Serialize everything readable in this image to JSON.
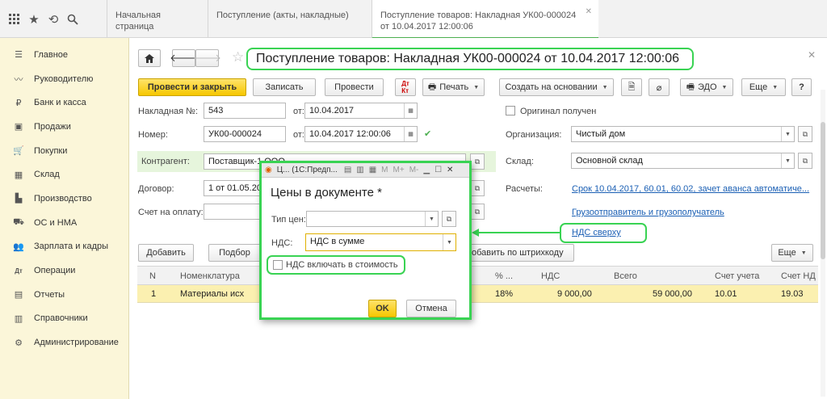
{
  "topbar": {
    "icons": [
      "apps-grid-icon",
      "star-icon",
      "history-icon",
      "search-icon"
    ],
    "tabs": [
      {
        "label": "Начальная страница"
      },
      {
        "label": "Поступление (акты, накладные)"
      },
      {
        "label_line1": "Поступление товаров: Накладная УК00-000024",
        "label_line2": "от 10.04.2017 12:00:06"
      }
    ]
  },
  "sidebar": {
    "items": [
      {
        "label": "Главное",
        "icon": "menu-icon"
      },
      {
        "label": "Руководителю",
        "icon": "chart-trend-icon"
      },
      {
        "label": "Банк и касса",
        "icon": "ruble-icon"
      },
      {
        "label": "Продажи",
        "icon": "bag-icon"
      },
      {
        "label": "Покупки",
        "icon": "cart-icon"
      },
      {
        "label": "Склад",
        "icon": "warehouse-icon"
      },
      {
        "label": "Производство",
        "icon": "factory-icon"
      },
      {
        "label": "ОС и НМА",
        "icon": "truck-icon"
      },
      {
        "label": "Зарплата и кадры",
        "icon": "people-icon"
      },
      {
        "label": "Операции",
        "icon": "dt-kt-icon"
      },
      {
        "label": "Отчеты",
        "icon": "report-icon"
      },
      {
        "label": "Справочники",
        "icon": "book-icon"
      },
      {
        "label": "Администрирование",
        "icon": "gear-icon"
      }
    ]
  },
  "document": {
    "title": "Поступление товаров: Накладная УК00-000024 от 10.04.2017 12:00:06",
    "toolbar": {
      "post_close": "Провести и закрыть",
      "save": "Записать",
      "post": "Провести",
      "print": "Печать",
      "create_based": "Создать на основании",
      "edo": "ЭДО",
      "more": "Еще",
      "help": "?"
    },
    "fields": {
      "invoice_label": "Накладная №:",
      "invoice_value": "543",
      "from_label": "от:",
      "invoice_date": "10.04.2017",
      "number_label": "Номер:",
      "number_value": "УК00-000024",
      "number_date": "10.04.2017 12:00:06",
      "original_label": "Оригинал получен",
      "org_label": "Организация:",
      "org_value": "Чистый дом",
      "counterparty_label": "Контрагент:",
      "counterparty_value": "Поставщик-1 ООО",
      "warehouse_label": "Склад:",
      "warehouse_value": "Основной склад",
      "contract_label": "Договор:",
      "contract_value": "1 от 01.05.20",
      "settlements_label": "Расчеты:",
      "settlements_link": "Срок 10.04.2017, 60.01, 60.02, зачет аванса автоматиче...",
      "payment_label": "Счет на оплату:",
      "consignor_link": "Грузоотправитель и грузополучатель",
      "vat_link": "НДС сверху"
    },
    "table_toolbar": {
      "add": "Добавить",
      "pick": "Подбор",
      "add_barcode": "Добавить по штрихкоду",
      "more": "Еще"
    },
    "table": {
      "columns": [
        "N",
        "Номенклатура",
        "% ...",
        "НДС",
        "Всего",
        "Счет учета",
        "Счет НД"
      ],
      "rows": [
        {
          "n": "1",
          "item": "Материалы исх",
          "vat_rate": "18%",
          "vat": "9 000,00",
          "total": "59 000,00",
          "account": "10.01",
          "vat_account": "19.03"
        }
      ]
    }
  },
  "dialog": {
    "window_title": "Ц... (1С:Предп...",
    "heading": "Цены в документе *",
    "price_type_label": "Тип цен:",
    "price_type_value": "",
    "vat_label": "НДС:",
    "vat_value": "НДС в сумме",
    "include_vat_label": "НДС включать в стоимость",
    "ok": "OK",
    "cancel": "Отмена"
  },
  "colors": {
    "highlight_green": "#39d353",
    "primary_yellow": "#f6c700",
    "sidebar_bg": "#fbf6d9",
    "link_blue": "#1a5fb4"
  }
}
